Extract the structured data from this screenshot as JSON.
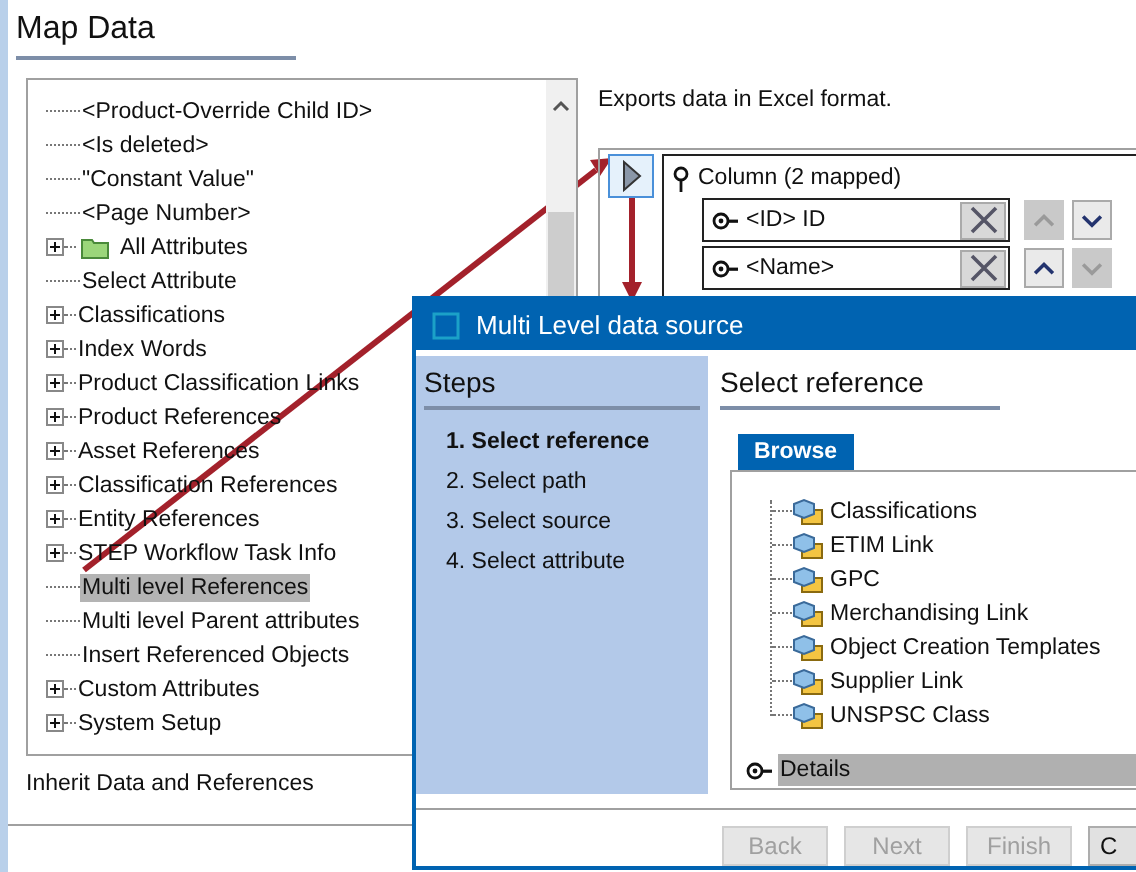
{
  "header": {
    "title": "Map Data"
  },
  "tree": {
    "items": [
      {
        "label": "<Product-Override Child ID>",
        "expandable": false,
        "kind": "plain",
        "selected": false
      },
      {
        "label": "<Is deleted>",
        "expandable": false,
        "kind": "plain",
        "selected": false
      },
      {
        "label": "\"Constant Value\"",
        "expandable": false,
        "kind": "plain",
        "selected": false
      },
      {
        "label": "<Page Number>",
        "expandable": false,
        "kind": "plain",
        "selected": false
      },
      {
        "label": "All Attributes",
        "expandable": true,
        "kind": "folder",
        "selected": false
      },
      {
        "label": "Select Attribute",
        "expandable": false,
        "kind": "plain",
        "selected": false
      },
      {
        "label": "Classifications",
        "expandable": true,
        "kind": "plain",
        "selected": false
      },
      {
        "label": "Index Words",
        "expandable": true,
        "kind": "plain",
        "selected": false
      },
      {
        "label": "Product Classification Links",
        "expandable": true,
        "kind": "plain",
        "selected": false
      },
      {
        "label": "Product References",
        "expandable": true,
        "kind": "plain",
        "selected": false
      },
      {
        "label": "Asset References",
        "expandable": true,
        "kind": "plain",
        "selected": false
      },
      {
        "label": "Classification References",
        "expandable": true,
        "kind": "plain",
        "selected": false
      },
      {
        "label": "Entity References",
        "expandable": true,
        "kind": "plain",
        "selected": false
      },
      {
        "label": "STEP Workflow Task Info",
        "expandable": true,
        "kind": "plain",
        "selected": false
      },
      {
        "label": "Multi level References",
        "expandable": false,
        "kind": "plain",
        "selected": true
      },
      {
        "label": "Multi level Parent attributes",
        "expandable": false,
        "kind": "plain",
        "selected": false
      },
      {
        "label": "Insert Referenced Objects",
        "expandable": false,
        "kind": "plain",
        "selected": false
      },
      {
        "label": "Custom Attributes",
        "expandable": true,
        "kind": "plain",
        "selected": false
      },
      {
        "label": "System Setup",
        "expandable": true,
        "kind": "plain",
        "selected": false
      }
    ]
  },
  "footer_text": "Inherit Data and References",
  "description": "Exports data in Excel format.",
  "mapping": {
    "group": "Column (2 mapped)",
    "rows": [
      {
        "label": "<ID> ID",
        "up_disabled": true,
        "down_disabled": false
      },
      {
        "label": "<Name>",
        "up_disabled": false,
        "down_disabled": true
      }
    ]
  },
  "dialog": {
    "title": "Multi Level data source",
    "steps_title": "Steps",
    "steps": [
      {
        "label": "1. Select reference",
        "selected": true
      },
      {
        "label": "2. Select path",
        "selected": false
      },
      {
        "label": "3. Select source",
        "selected": false
      },
      {
        "label": "4. Select attribute",
        "selected": false
      }
    ],
    "heading": "Select reference",
    "tabs": [
      {
        "label": "Browse",
        "selected": true
      }
    ],
    "tree": [
      "Classifications",
      "ETIM Link",
      "GPC",
      "Merchandising Link",
      "Object Creation Templates",
      "Supplier Link",
      "UNSPSC Class"
    ],
    "details": {
      "label": "Details"
    },
    "buttons": [
      {
        "label": "Back",
        "disabled": true
      },
      {
        "label": "Next",
        "disabled": true
      },
      {
        "label": "Finish",
        "disabled": true
      },
      {
        "label": "C",
        "disabled": false
      }
    ]
  }
}
